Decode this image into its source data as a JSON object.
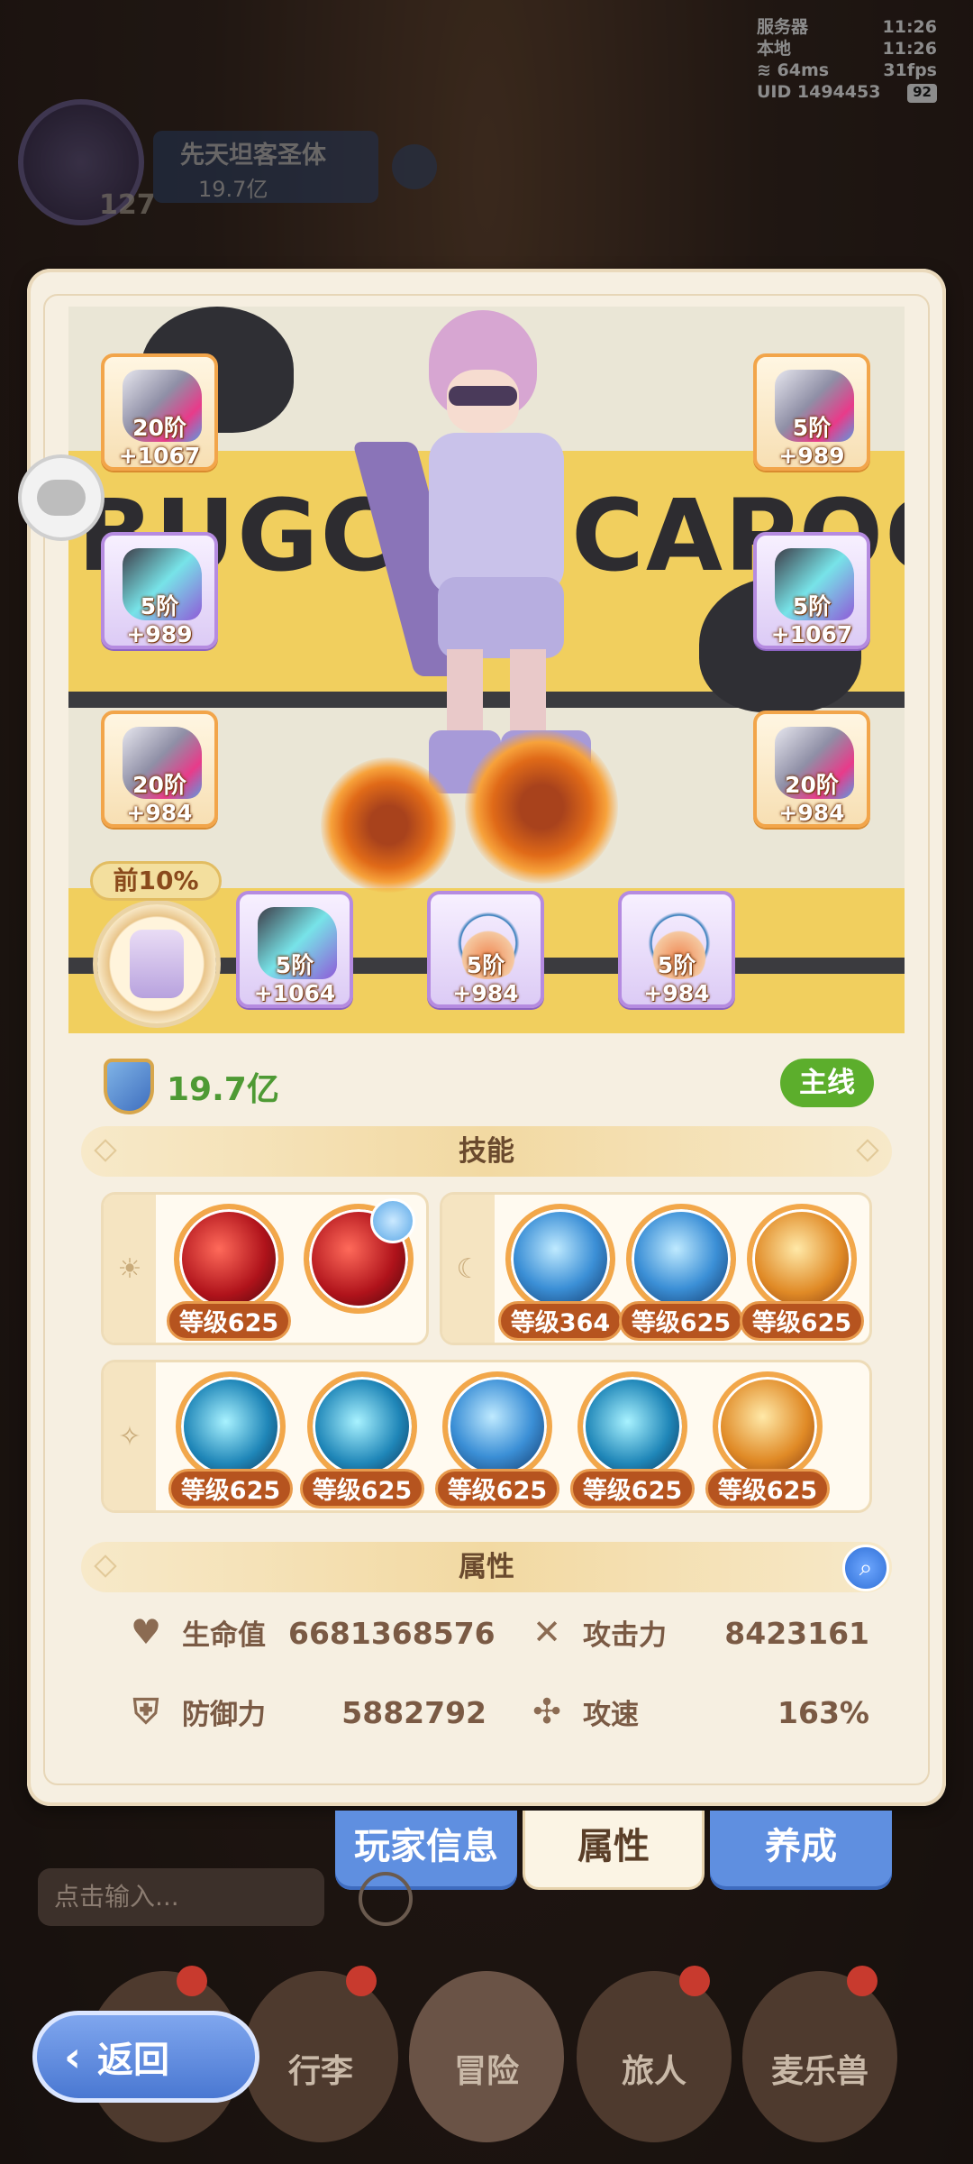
{
  "status_bar": {
    "server_label": "服务器",
    "server_time": "11:26",
    "local_label": "本地",
    "local_time": "11:26",
    "ping": "64ms",
    "fps": "31fps",
    "uid": "UID 1494453",
    "battery": "92"
  },
  "player_header": {
    "name": "先天坦客圣体",
    "power": "19.7亿",
    "level": "127"
  },
  "equipment": {
    "slots": [
      {
        "label": "20阶+1067"
      },
      {
        "label": "5阶 +989"
      },
      {
        "label": "5阶 +989"
      },
      {
        "label": "5阶+1067"
      },
      {
        "label": "20阶+984"
      },
      {
        "label": "20阶+984"
      },
      {
        "label": "5阶 +1064"
      },
      {
        "label": "5阶 +984"
      },
      {
        "label": "5阶 +984"
      }
    ],
    "rank_badge": "前10%"
  },
  "stage": {
    "banner_text": "BUGCAT CAPOO"
  },
  "summary": {
    "power": "19.7亿",
    "mainline_label": "主线"
  },
  "skills": {
    "section_title": "技能",
    "group1": [
      {
        "level": "等级625"
      },
      {
        "level": ""
      }
    ],
    "group2": [
      {
        "level": "等级364"
      },
      {
        "level": "等级625"
      },
      {
        "level": "等级625"
      }
    ],
    "group3": [
      {
        "level": "等级625"
      },
      {
        "level": "等级625"
      },
      {
        "level": "等级625"
      },
      {
        "level": "等级625"
      },
      {
        "level": "等级625"
      }
    ]
  },
  "attributes": {
    "section_title": "属性",
    "hp_label": "生命值",
    "hp_value": "6681368576",
    "atk_label": "攻击力",
    "atk_value": "8423161",
    "def_label": "防御力",
    "def_value": "5882792",
    "spd_label": "攻速",
    "spd_value": "163%"
  },
  "bottom_tabs": {
    "player_info": "玩家信息",
    "attributes": "属性",
    "cultivate": "养成"
  },
  "chat": {
    "placeholder": "点击输入..."
  },
  "nav": {
    "back": "返回",
    "luggage": "行李",
    "adventure": "冒险",
    "traveler": "旅人",
    "pet": "麦乐兽"
  }
}
